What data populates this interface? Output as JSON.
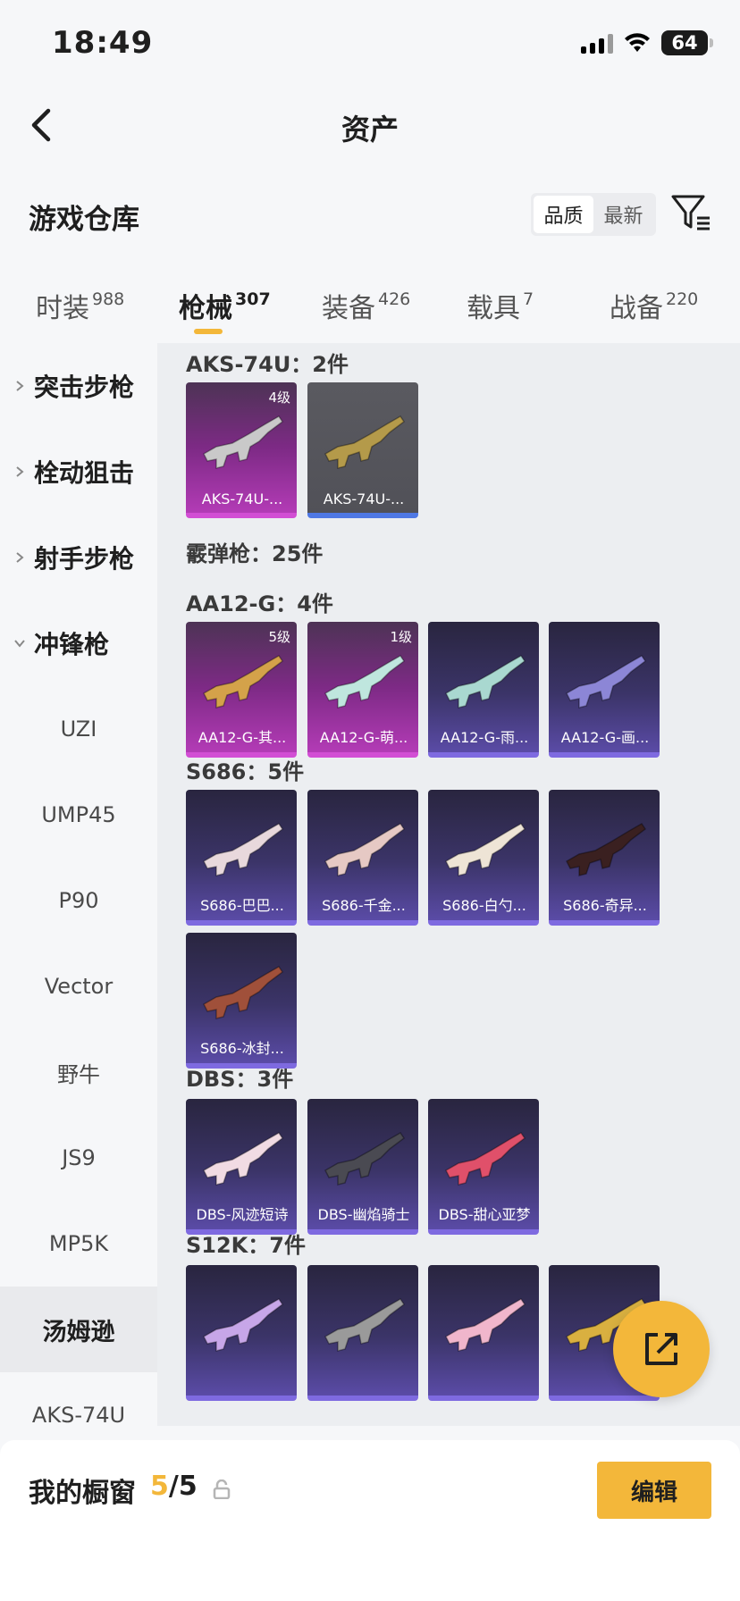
{
  "status_bar": {
    "time": "18:49",
    "battery": "64"
  },
  "header": {
    "title": "资产"
  },
  "warehouse": {
    "title": "游戏仓库",
    "sort_options": [
      {
        "label": "品质",
        "active": true
      },
      {
        "label": "最新",
        "active": false
      }
    ]
  },
  "tabs": [
    {
      "label": "时装",
      "count": "988",
      "active": false
    },
    {
      "label": "枪械",
      "count": "307",
      "active": true
    },
    {
      "label": "装备",
      "count": "426",
      "active": false
    },
    {
      "label": "载具",
      "count": "7",
      "active": false
    },
    {
      "label": "战备",
      "count": "220",
      "active": false
    }
  ],
  "sidebar": {
    "categories": [
      {
        "label": "突击步枪",
        "expanded": false
      },
      {
        "label": "栓动狙击",
        "expanded": false
      },
      {
        "label": "射手步枪",
        "expanded": false
      },
      {
        "label": "冲锋枪",
        "expanded": true
      }
    ],
    "subitems": [
      {
        "label": "UZI",
        "selected": false
      },
      {
        "label": "UMP45",
        "selected": false
      },
      {
        "label": "P90",
        "selected": false
      },
      {
        "label": "Vector",
        "selected": false
      },
      {
        "label": "野牛",
        "selected": false
      },
      {
        "label": "JS9",
        "selected": false
      },
      {
        "label": "MP5K",
        "selected": false
      },
      {
        "label": "汤姆逊",
        "selected": true
      },
      {
        "label": "AKS-74U",
        "selected": false
      }
    ]
  },
  "content": {
    "sections": {
      "aks": "AKS-74U：2件",
      "shotgun": "霰弹枪：25件",
      "aa12": "AA12-G：4件",
      "s686": "S686：5件",
      "dbs": "DBS：3件",
      "s12k": "S12K：7件"
    },
    "cards": {
      "aks": [
        {
          "name": "AKS-74U-...",
          "level": "4级",
          "rarity": "pink",
          "gun_color": "#c9c9c9"
        },
        {
          "name": "AKS-74U-...",
          "level": "",
          "rarity": "gray",
          "gun_color": "#b49a4a"
        }
      ],
      "aa12": [
        {
          "name": "AA12-G-其...",
          "level": "5级",
          "rarity": "pink",
          "gun_color": "#d4a24a"
        },
        {
          "name": "AA12-G-萌...",
          "level": "1级",
          "rarity": "pink",
          "gun_color": "#bfe6de"
        },
        {
          "name": "AA12-G-雨...",
          "level": "",
          "rarity": "blue",
          "gun_color": "#a9d8d0"
        },
        {
          "name": "AA12-G-画...",
          "level": "",
          "rarity": "blue",
          "gun_color": "#8c86d6"
        }
      ],
      "s686": [
        {
          "name": "S686-巴巴...",
          "level": "",
          "rarity": "blue",
          "gun_color": "#e8d8dc"
        },
        {
          "name": "S686-千金...",
          "level": "",
          "rarity": "blue",
          "gun_color": "#e6c9c4"
        },
        {
          "name": "S686-白勺...",
          "level": "",
          "rarity": "blue",
          "gun_color": "#eee4d6"
        },
        {
          "name": "S686-奇异...",
          "level": "",
          "rarity": "blue",
          "gun_color": "#3a2020"
        },
        {
          "name": "S686-冰封...",
          "level": "",
          "rarity": "blue",
          "gun_color": "#a0503a"
        }
      ],
      "dbs": [
        {
          "name": "DBS-风迹短诗",
          "level": "",
          "rarity": "blue",
          "gun_color": "#f1dbe3"
        },
        {
          "name": "DBS-幽焰骑士",
          "level": "",
          "rarity": "blue",
          "gun_color": "#4a4a52"
        },
        {
          "name": "DBS-甜心亚梦",
          "level": "",
          "rarity": "blue",
          "gun_color": "#e0506a"
        }
      ],
      "s12k": [
        {
          "name": "",
          "level": "",
          "rarity": "blue",
          "gun_color": "#c7a6e8"
        },
        {
          "name": "",
          "level": "",
          "rarity": "blue",
          "gun_color": "#9a9a9a"
        },
        {
          "name": "",
          "level": "",
          "rarity": "blue",
          "gun_color": "#f0b6cc"
        },
        {
          "name": "",
          "level": "",
          "rarity": "blue",
          "gun_color": "#d9b040"
        }
      ]
    }
  },
  "bottom_bar": {
    "label": "我的橱窗",
    "current": "5",
    "separator": "/",
    "total": "5",
    "edit_label": "编辑"
  },
  "accent_color": "#f3b73a"
}
